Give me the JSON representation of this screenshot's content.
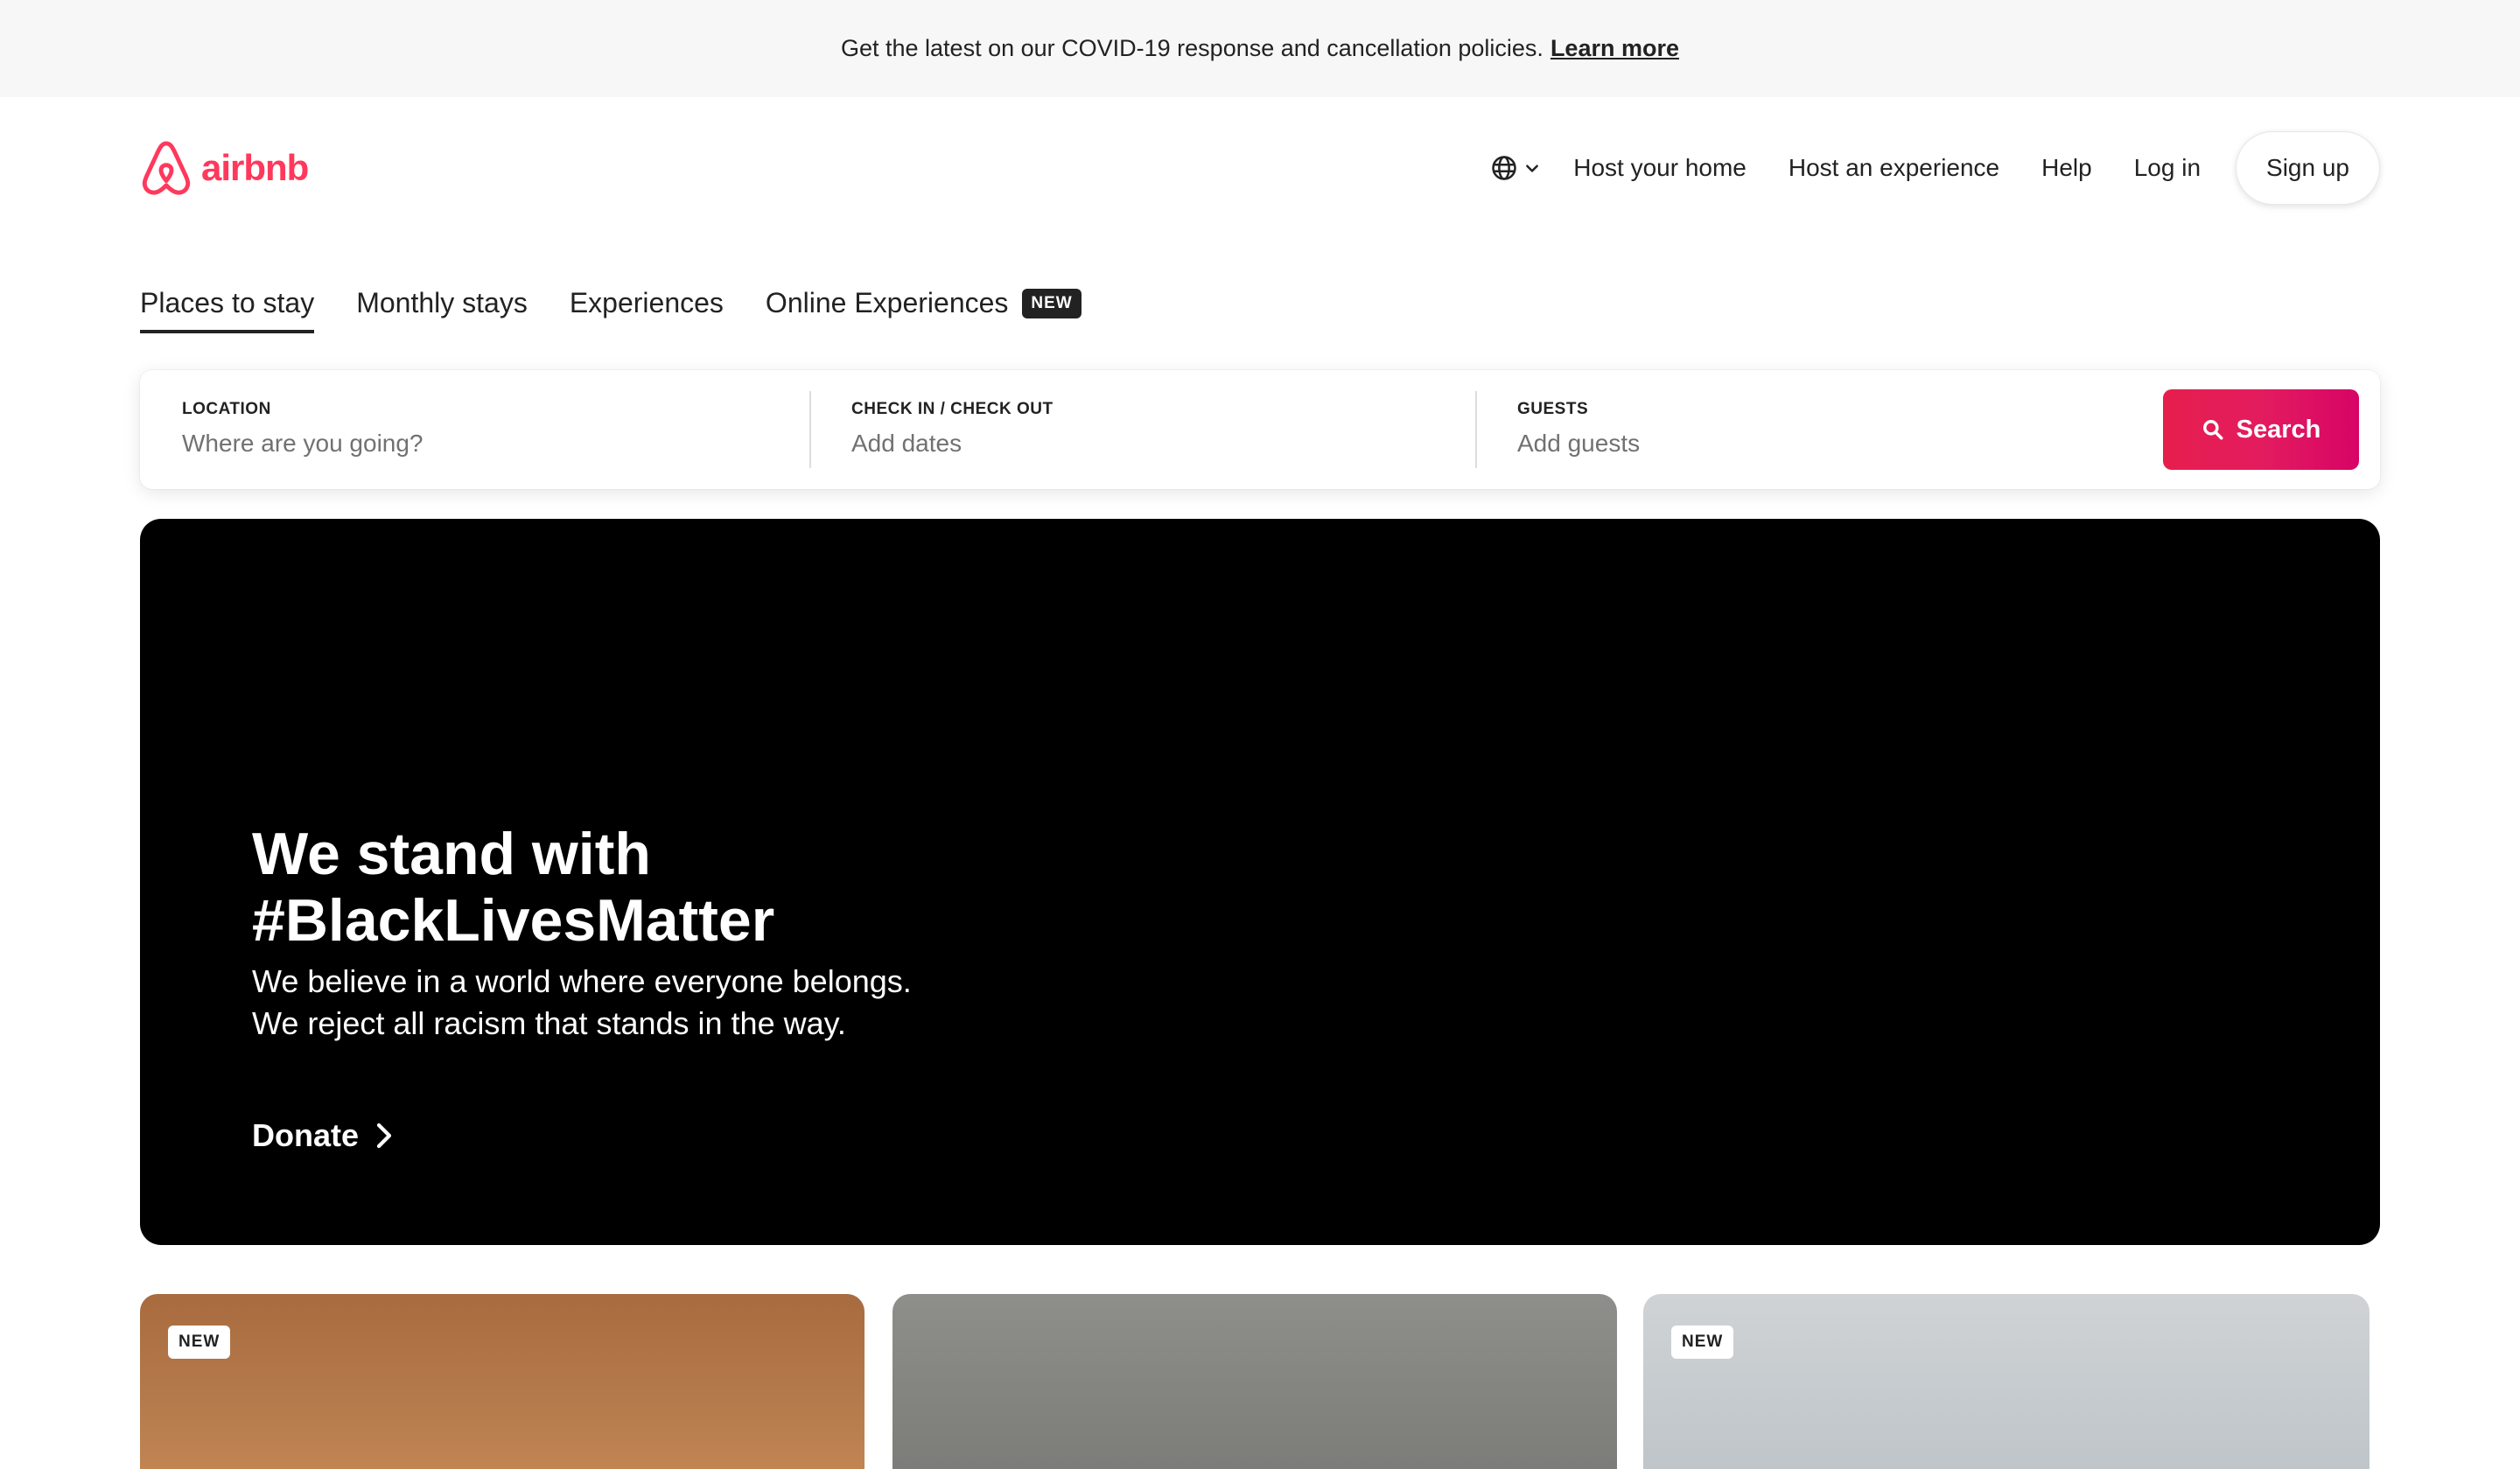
{
  "banner": {
    "message": "Get the latest on our COVID-19 response and cancellation policies.",
    "link": "Learn more"
  },
  "header": {
    "logo_text": "airbnb",
    "nav": {
      "host_home": "Host your home",
      "host_experience": "Host an experience",
      "help": "Help",
      "login": "Log in",
      "signup": "Sign up"
    }
  },
  "tabs": [
    {
      "label": "Places to stay",
      "active": true
    },
    {
      "label": "Monthly stays",
      "active": false
    },
    {
      "label": "Experiences",
      "active": false
    },
    {
      "label": "Online Experiences",
      "active": false,
      "badge": "NEW"
    }
  ],
  "search": {
    "location": {
      "label": "LOCATION",
      "placeholder": "Where are you going?"
    },
    "dates": {
      "label": "CHECK IN / CHECK OUT",
      "placeholder": "Add dates"
    },
    "guests": {
      "label": "GUESTS",
      "placeholder": "Add guests"
    },
    "button": "Search"
  },
  "hero": {
    "title_line1": "We stand with",
    "title_line2": "#BlackLivesMatter",
    "body": "We believe in a world where everyone belongs. We reject all racism that stands in the way.",
    "cta": "Donate"
  },
  "cards": [
    {
      "badge": "NEW"
    },
    {
      "badge": ""
    },
    {
      "badge": "NEW"
    }
  ],
  "colors": {
    "brand": "#ff385c",
    "search_button": "#e31c5f",
    "text": "#222222",
    "muted": "#717171",
    "banner_bg": "#f7f7f7"
  }
}
